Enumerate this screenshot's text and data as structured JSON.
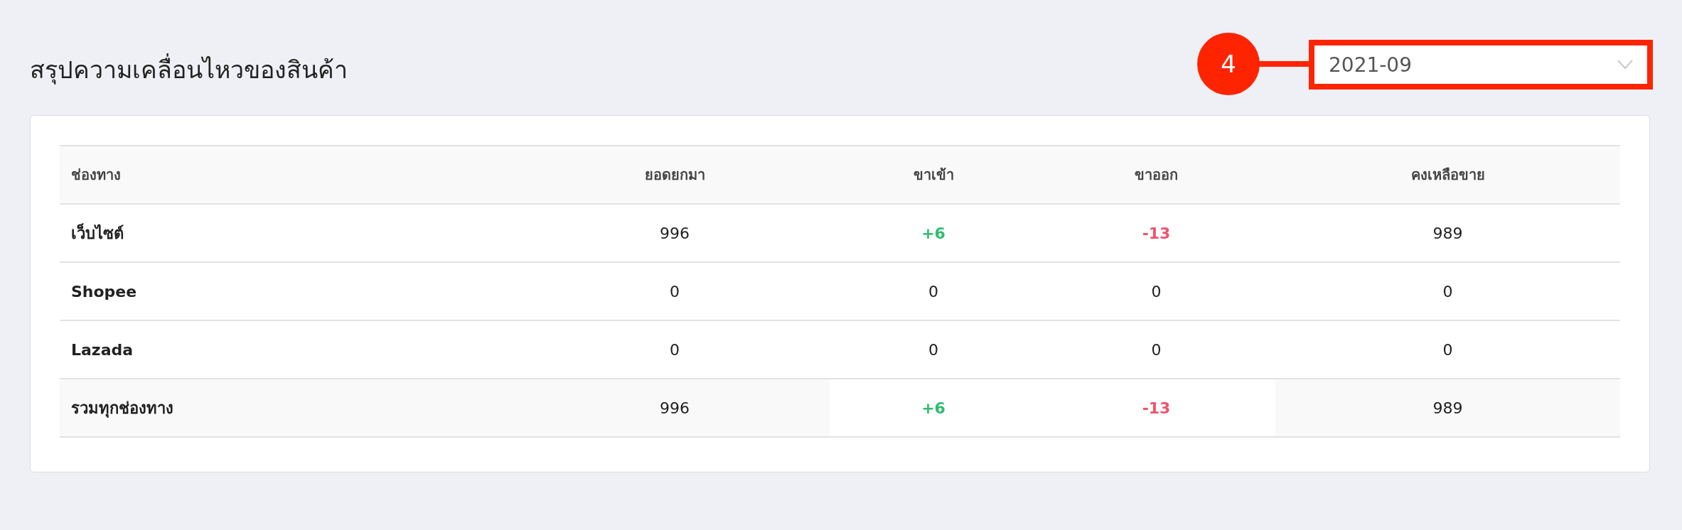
{
  "title": "สรุปความเคลื่อนไหวของสินค้า",
  "period_select": {
    "value": "2021-09",
    "annotation": "4"
  },
  "table": {
    "columns": [
      "ช่องทาง",
      "ยอดยกมา",
      "ขาเข้า",
      "ขาออก",
      "คงเหลือขาย"
    ],
    "rows": [
      {
        "kind": "channel",
        "has_movement": true,
        "cells": [
          "เว็บไซต์",
          "996",
          "+6",
          "-13",
          "989"
        ]
      },
      {
        "kind": "channel",
        "has_movement": false,
        "cells": [
          "Shopee",
          "0",
          "0",
          "0",
          "0"
        ]
      },
      {
        "kind": "channel",
        "has_movement": false,
        "cells": [
          "Lazada",
          "0",
          "0",
          "0",
          "0"
        ]
      },
      {
        "kind": "total",
        "has_movement": true,
        "cells": [
          "รวมทุกช่องทาง",
          "996",
          "+6",
          "-13",
          "989"
        ]
      }
    ]
  }
}
